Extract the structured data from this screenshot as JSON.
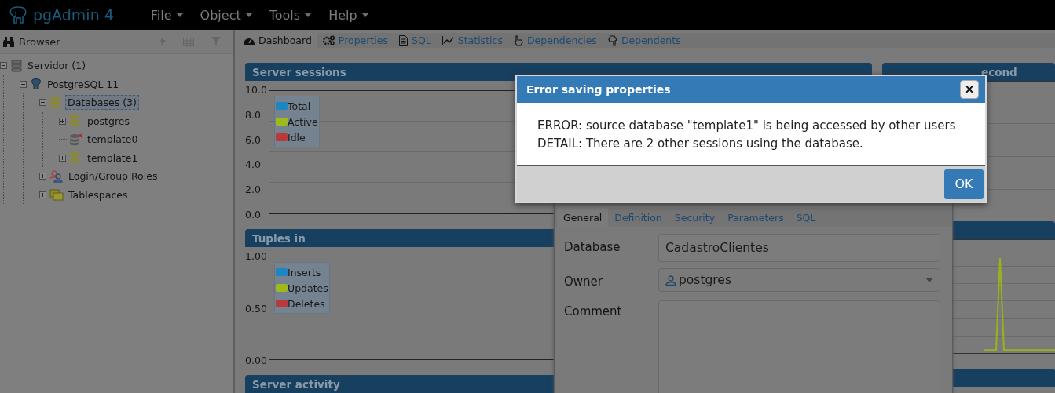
{
  "app": {
    "title": "pgAdmin 4"
  },
  "menu": [
    {
      "label": "File"
    },
    {
      "label": "Object"
    },
    {
      "label": "Tools"
    },
    {
      "label": "Help"
    }
  ],
  "browser": {
    "title": "Browser",
    "tree": [
      {
        "label": "Servidor (1)",
        "kind": "server",
        "selected": false,
        "expanded": true,
        "children": [
          {
            "label": "PostgreSQL 11",
            "kind": "postgres",
            "selected": false,
            "expanded": true,
            "children": [
              {
                "label": "Databases (3)",
                "kind": "database",
                "selected": true,
                "expanded": true,
                "children": [
                  {
                    "label": "postgres",
                    "kind": "database",
                    "selected": false,
                    "expanded": false
                  },
                  {
                    "label": "template0",
                    "kind": "database-disconnected",
                    "selected": false
                  },
                  {
                    "label": "template1",
                    "kind": "database",
                    "selected": false,
                    "expanded": false
                  }
                ]
              },
              {
                "label": "Login/Group Roles",
                "kind": "roles",
                "selected": false,
                "expanded": false
              },
              {
                "label": "Tablespaces",
                "kind": "tablespace",
                "selected": false,
                "expanded": false
              }
            ]
          }
        ]
      }
    ]
  },
  "tabs": [
    {
      "label": "Dashboard",
      "selected": true
    },
    {
      "label": "Properties",
      "selected": false
    },
    {
      "label": "SQL",
      "selected": false
    },
    {
      "label": "Statistics",
      "selected": false
    },
    {
      "label": "Dependencies",
      "selected": false
    },
    {
      "label": "Dependents",
      "selected": false
    }
  ],
  "server_sessions": {
    "title": "Server sessions",
    "y_labels": [
      "10.0",
      "8.0",
      "6.0",
      "4.0",
      "2.0",
      "0.0"
    ],
    "legend": [
      {
        "label": "Total",
        "color": "#1f85c2"
      },
      {
        "label": "Active",
        "color": "#a0b91d"
      },
      {
        "label": "Idle",
        "color": "#b83a3a"
      }
    ]
  },
  "transactions": {
    "title": "econd"
  },
  "tuples_in": {
    "title": "Tuples in",
    "y_labels": [
      "1.00",
      "0.50",
      "0.00"
    ],
    "legend": [
      {
        "label": "Inserts",
        "color": "#1f85c2"
      },
      {
        "label": "Updates",
        "color": "#a0b91d"
      },
      {
        "label": "Deletes",
        "color": "#b83a3a"
      }
    ]
  },
  "server_activity": {
    "title": "Server activity"
  },
  "properties_dialog": {
    "tabs": [
      {
        "label": "General",
        "selected": true
      },
      {
        "label": "Definition",
        "selected": false
      },
      {
        "label": "Security",
        "selected": false
      },
      {
        "label": "Parameters",
        "selected": false
      },
      {
        "label": "SQL",
        "selected": false
      }
    ],
    "fields": [
      {
        "label": "Database",
        "kind": "text",
        "value": "CadastroClientes"
      },
      {
        "label": "Owner",
        "kind": "select",
        "value": "postgres"
      },
      {
        "label": "Comment",
        "kind": "textarea"
      }
    ]
  },
  "error_dialog": {
    "title": "Error saving properties",
    "close": "×",
    "lines": [
      "ERROR: source database \"template1\" is being accessed by other users",
      "DETAIL: There are 2 other sessions using the database."
    ],
    "button": "OK"
  }
}
